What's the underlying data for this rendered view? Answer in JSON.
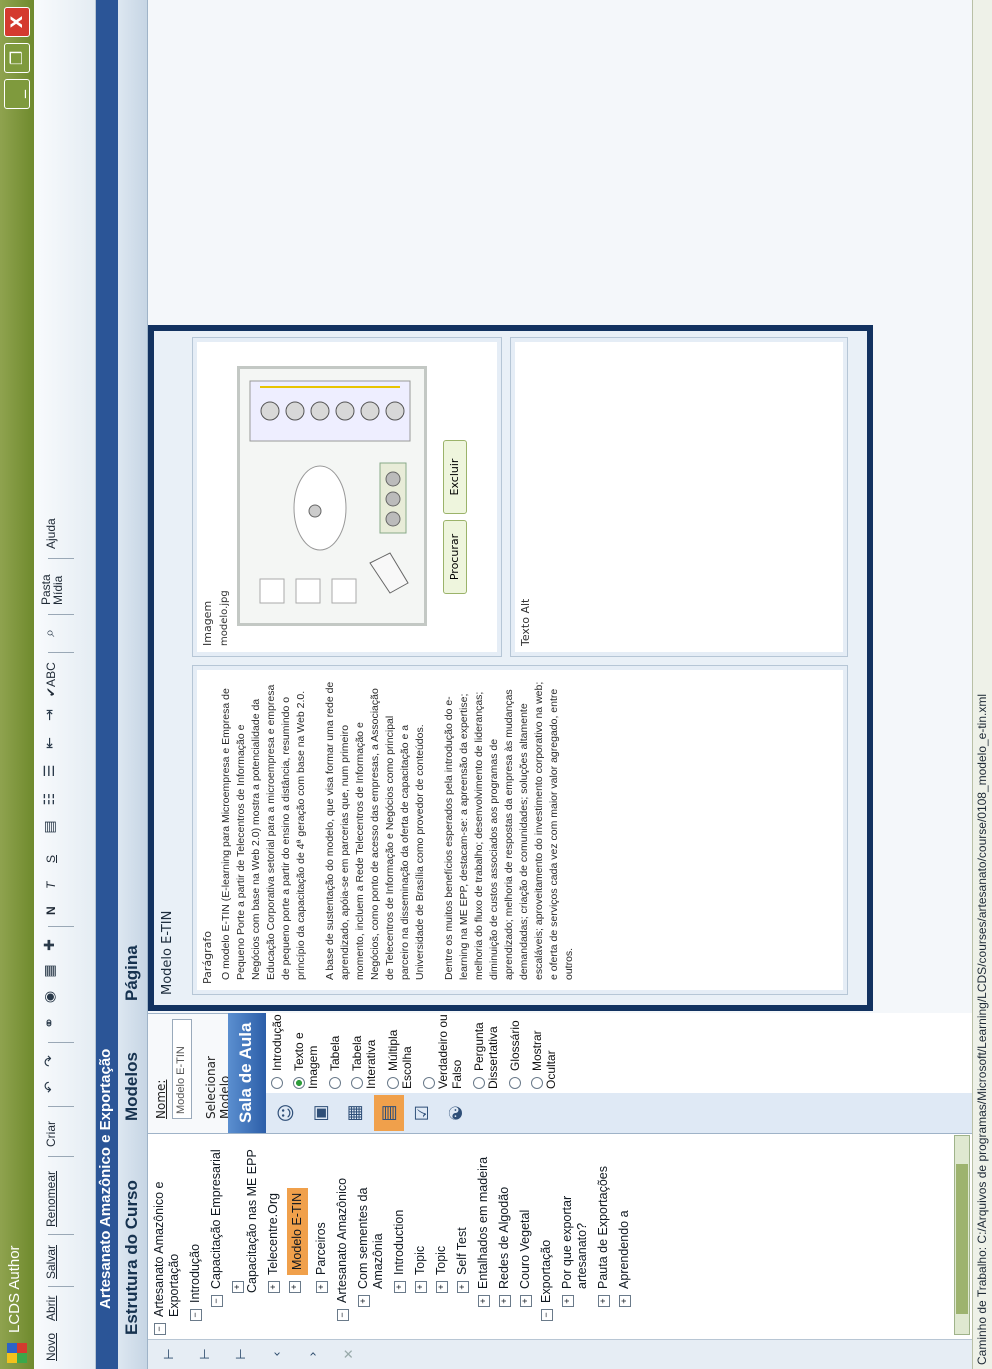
{
  "window": {
    "app_title": "LCDS Author",
    "controls": {
      "minimize": "_",
      "maximize": "❐",
      "close": "X"
    }
  },
  "toolbar": {
    "items": [
      {
        "label": "Novo"
      },
      {
        "label": "Abrir"
      },
      {
        "label": "Salvar"
      },
      {
        "label": "Renomear"
      },
      {
        "label": "Criar"
      },
      {
        "label": "Pasta Mídia"
      },
      {
        "label": "Ajuda"
      }
    ],
    "format_marks": [
      "N",
      "T",
      "S",
      "ABC"
    ]
  },
  "project_title": "Artesanato Amazônico e Exportação",
  "tree": {
    "title": "Estrutura do Curso",
    "nodes": [
      {
        "label": "Artesanato Amazônico e Exportação",
        "expander": "−"
      },
      {
        "label": "Introdução",
        "expander": "−"
      },
      {
        "label": "Capacitação Empresarial",
        "expander": "−"
      },
      {
        "label": "Capacitação nas ME EPP",
        "expander": "+"
      },
      {
        "label": "Telecentre.Org",
        "expander": "+"
      },
      {
        "label": "Modelo E-TIN",
        "expander": "+",
        "selected": true
      },
      {
        "label": "Parceiros",
        "expander": "+"
      },
      {
        "label": "Artesanato Amazônico",
        "expander": "−"
      },
      {
        "label": "Com sementes da Amazônia",
        "expander": "+"
      },
      {
        "label": "Introduction",
        "expander": "+"
      },
      {
        "label": "Topic",
        "expander": "+"
      },
      {
        "label": "Topic",
        "expander": "+"
      },
      {
        "label": "Self Test",
        "expander": "+"
      },
      {
        "label": "Entalhados em madeira",
        "expander": "+"
      },
      {
        "label": "Redes de Algodão",
        "expander": "+"
      },
      {
        "label": "Couro Vegetal",
        "expander": "+"
      },
      {
        "label": "Exportação",
        "expander": "−"
      },
      {
        "label": "Por que exportar artesanato?",
        "expander": "+"
      },
      {
        "label": "Pauta de Exportações",
        "expander": "+"
      },
      {
        "label": "Aprendendo a",
        "expander": "+"
      }
    ]
  },
  "models": {
    "title": "Modelos",
    "nome_label": "Nome:",
    "nome_value": "Modelo E-TIN",
    "select_label": "Selecionar Modelo",
    "sala_title": "Sala de Aula",
    "options": [
      {
        "label": "Introdução",
        "selected": false
      },
      {
        "label": "Texto e Imagem",
        "selected": true
      },
      {
        "label": "Tabela",
        "selected": false
      },
      {
        "label": "Tabela Interativa",
        "selected": false
      },
      {
        "label": "Múltipla Escolha",
        "selected": false
      },
      {
        "label": "Verdadeiro ou Falso",
        "selected": false
      },
      {
        "label": "Pergunta Dissertativa",
        "selected": false
      },
      {
        "label": "Glossário",
        "selected": false
      },
      {
        "label": "Mostrar Ocultar",
        "selected": false
      }
    ]
  },
  "page": {
    "title": "Página",
    "model_name": "Modelo E-TIN",
    "paragraph_label": "Parágrafo",
    "paragraphs": [
      "O modelo E-TIN (E-learning para Microempresa e Empresa de Pequeno Porte a partir de Telecentros de Informação e Negócios com base na Web 2.0) mostra a potencialidade da Educação Corporativa setorial para a microempresa e empresa de pequeno porte a partir do ensino a distância, resumindo o princípio da capacitação de 4ª geração com base na Web 2.0.",
      "A base de sustentação do modelo, que visa formar uma rede de aprendizado, apóia-se em parcerias que, num primeiro momento, incluem a Rede Telecentros de Informação e Negócios, como ponto de acesso das empresas, a Associação de Telecentros de Informação e Negócios como principal parceiro na disseminação da oferta de capacitação e a Universidade de Brasília como provedor de conteúdos.",
      "Dentre os muitos benefícios esperados pela introdução do e-learning na ME EPP, destacam-se: a apreensão da expertise; melhoria do fluxo de trabalho; desenvolvimento de lideranças; diminuição de custos associados aos programas de aprendizado; melhoria de respostas da empresa às mudanças demandadas; criação de comunidades; soluções altamente escaláveis; aproveitamento do investimento corporativo na web; e oferta de serviços cada vez com maior valor agregado, entre outros."
    ],
    "image_label": "Imagem",
    "image_file": "modelo.jpg",
    "procurar_label": "Procurar",
    "excluir_label": "Excluir",
    "alt_label": "Texto Alt",
    "alt_value": ""
  },
  "status": {
    "text": "Caminho de Trabalho: C:/Arquivos de programas/Microsoft/Learning/LCDS/courses/artesanato/course/0108_modelo_e-tin.xml"
  }
}
